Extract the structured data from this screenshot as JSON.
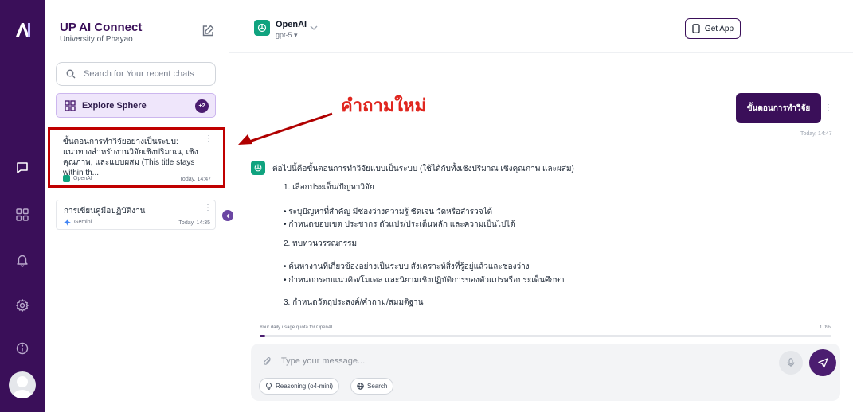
{
  "sidebar": {
    "brand_title": "UP AI Connect",
    "brand_subtitle": "University of Phayao",
    "search_placeholder": "Search for Your recent chats",
    "explore_label": "Explore Sphere",
    "explore_badge": "+2",
    "chats": [
      {
        "title": "ขั้นตอนการทำวิจัยอย่างเป็นระบบ: แนวทางสำหรับงานวิจัยเชิงปริมาณ, เชิงคุณภาพ, และแบบผสม (This title stays within th...",
        "model": "OpenAI",
        "time": "Today, 14:47"
      },
      {
        "title": "การเขียนคู่มือปฏิบัติงาน",
        "model": "Gemini",
        "time": "Today, 14:35"
      }
    ]
  },
  "annotation": {
    "text": "คำถามใหม่"
  },
  "header": {
    "model_name": "OpenAI",
    "model_version": "gpt-5 ▾",
    "get_app_label": "Get App"
  },
  "conversation": {
    "user_message": "ขั้นตอนการทำวิจัย",
    "user_time": "Today, 14:47",
    "bot_intro": "ต่อไปนี้คือขั้นตอนการทำวิจัยแบบเป็นระบบ (ใช้ได้กับทั้งเชิงปริมาณ เชิงคุณภาพ และผสม)",
    "bot_lines": [
      "1. เลือกประเด็น/ปัญหาวิจัย",
      "• ระบุปัญหาที่สำคัญ มีช่องว่างความรู้ ชัดเจน วัดหรือสำรวจได้",
      "• กำหนดขอบเขต ประชากร ตัวแปร/ประเด็นหลัก และความเป็นไปได้",
      "2. ทบทวนวรรณกรรม",
      "• ค้นหางานที่เกี่ยวข้องอย่างเป็นระบบ สังเคราะห์สิ่งที่รู้อยู่แล้วและช่องว่าง",
      "• กำหนดกรอบแนวคิด/โมเดล และนิยามเชิงปฏิบัติการของตัวแปรหรือประเด็นศึกษา",
      "3. กำหนดวัตถุประสงค์/คำถาม/สมมติฐาน"
    ]
  },
  "usage": {
    "label": "Your daily usage quota for OpenAI",
    "percent_label": "1.0%",
    "percent": 1.0
  },
  "composer": {
    "placeholder": "Type your message...",
    "chip_reasoning": "Reasoning (o4-mini)",
    "chip_search": "Search"
  },
  "colors": {
    "brand_purple": "#3a0f59",
    "accent_purple": "#4b1d70",
    "annotation_red": "#e0261f",
    "openai_green": "#10a37f"
  }
}
